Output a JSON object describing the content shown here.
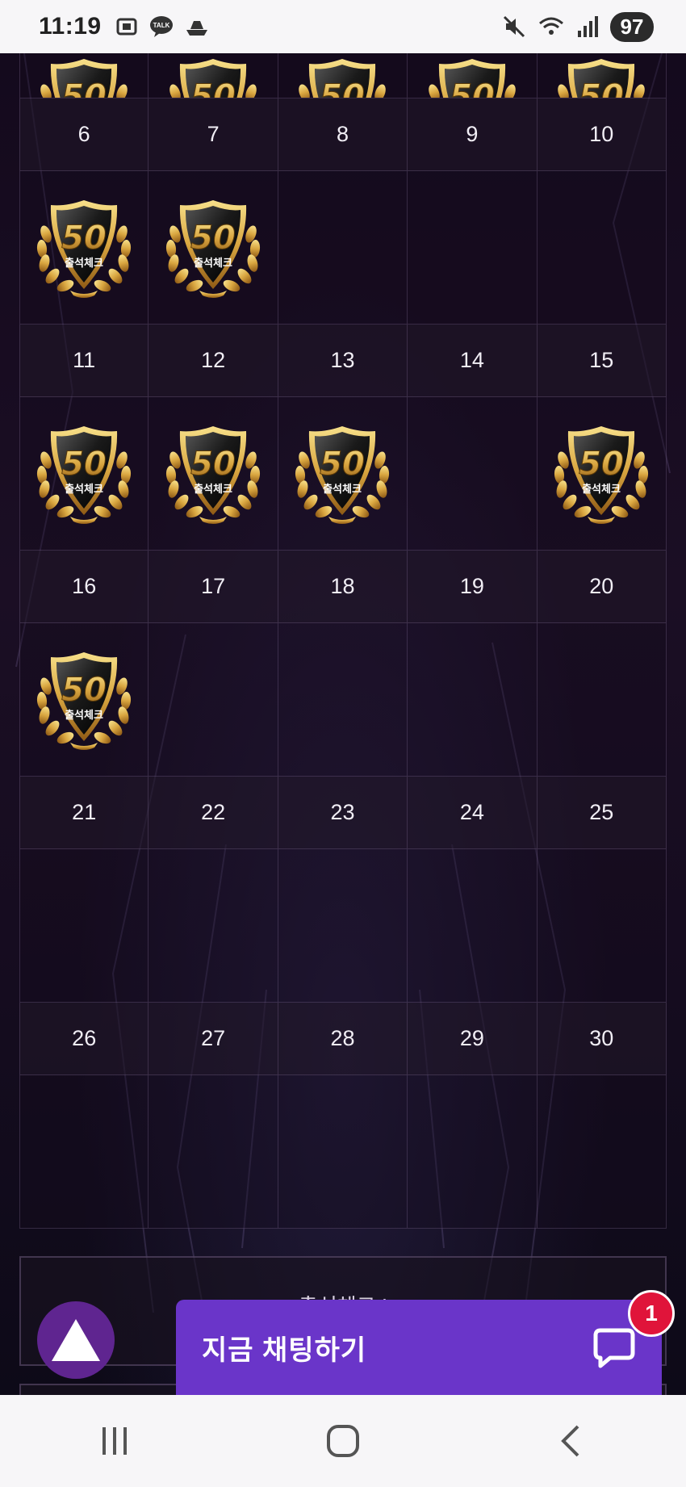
{
  "status_bar": {
    "time": "11:19",
    "battery": "97",
    "icons": [
      "screenshot-icon",
      "kakaotalk-icon",
      "boat-icon",
      "mute-icon",
      "wifi-icon",
      "signal-icon"
    ]
  },
  "calendar": {
    "weeks": [
      {
        "days": [
          "6",
          "7",
          "8",
          "9",
          "10"
        ],
        "stamps_above": [
          true,
          true,
          true,
          true,
          true
        ]
      },
      {
        "days": [
          "11",
          "12",
          "13",
          "14",
          "15"
        ],
        "stamps_above": [
          true,
          true,
          false,
          false,
          false
        ]
      },
      {
        "days": [
          "16",
          "17",
          "18",
          "19",
          "20"
        ],
        "stamps_above": [
          true,
          true,
          true,
          false,
          true
        ]
      },
      {
        "days": [
          "21",
          "22",
          "23",
          "24",
          "25"
        ],
        "stamps_above": [
          true,
          false,
          false,
          false,
          false
        ]
      },
      {
        "days": [
          "26",
          "27",
          "28",
          "29",
          "30"
        ],
        "stamps_above": [
          false,
          false,
          false,
          false,
          false
        ]
      }
    ],
    "badge": {
      "number": "50",
      "caption": "출석체크"
    },
    "trailing_stamps": [
      false,
      false,
      false,
      false,
      false
    ]
  },
  "section_card": {
    "title": "출석체크 !"
  },
  "chat": {
    "label": "지금 채팅하기",
    "unread_count": "1"
  },
  "colors": {
    "chat": "#6a35c9",
    "scroll_top": "#5f2590",
    "badge_gold": "#d9a640",
    "unread": "#e0143a"
  }
}
